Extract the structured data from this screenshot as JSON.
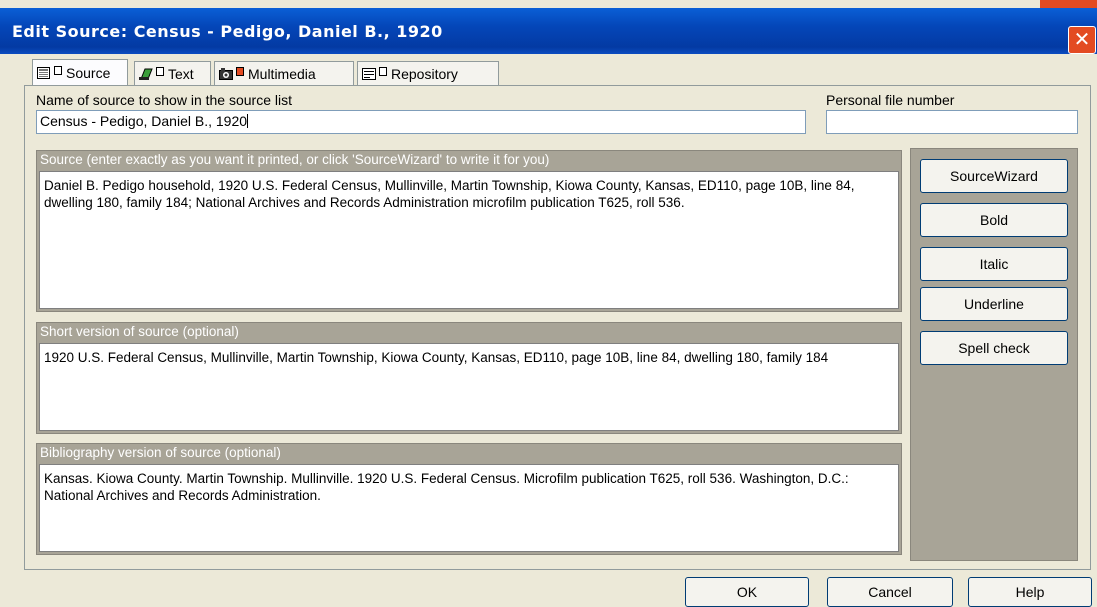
{
  "window": {
    "title": "Edit Source: Census - Pedigo, Daniel B., 1920",
    "close_glyph": "✕"
  },
  "tabs": [
    {
      "label": "Source",
      "icon": "source-icon"
    },
    {
      "label": "Text",
      "icon": "text-icon"
    },
    {
      "label": "Multimedia",
      "icon": "camera-icon"
    },
    {
      "label": "Repository",
      "icon": "repository-icon"
    }
  ],
  "fields": {
    "name_label": "Name of source to show in the source list",
    "name_value": "Census - Pedigo, Daniel B., 1920",
    "file_number_label": "Personal file number",
    "file_number_value": ""
  },
  "sections": {
    "source": {
      "header": "Source (enter exactly as you want it printed, or click 'SourceWizard' to write it for you)",
      "text": "Daniel B. Pedigo household, 1920 U.S. Federal Census, Mullinville, Martin Township, Kiowa County, Kansas, ED110, page 10B, line 84, dwelling 180, family 184; National Archives and Records Administration microfilm publication T625, roll 536."
    },
    "short": {
      "header": "Short version of source (optional)",
      "text": "1920 U.S. Federal Census, Mullinville, Martin Township, Kiowa County, Kansas, ED110, page 10B, line 84, dwelling 180, family 184"
    },
    "bibliography": {
      "header": "Bibliography version of source (optional)",
      "text": "Kansas. Kiowa County. Martin Township. Mullinville. 1920 U.S. Federal Census. Microfilm publication T625, roll 536. Washington, D.C.: National Archives and Records Administration."
    }
  },
  "side_buttons": {
    "wizard": "SourceWizard",
    "bold": "Bold",
    "italic": "Italic",
    "underline": "Underline",
    "spell": "Spell check"
  },
  "footer": {
    "ok": "OK",
    "cancel": "Cancel",
    "help": "Help"
  },
  "colors": {
    "titlebar": "#0446b8",
    "close": "#e34b22",
    "group_header": "#a8a497"
  }
}
